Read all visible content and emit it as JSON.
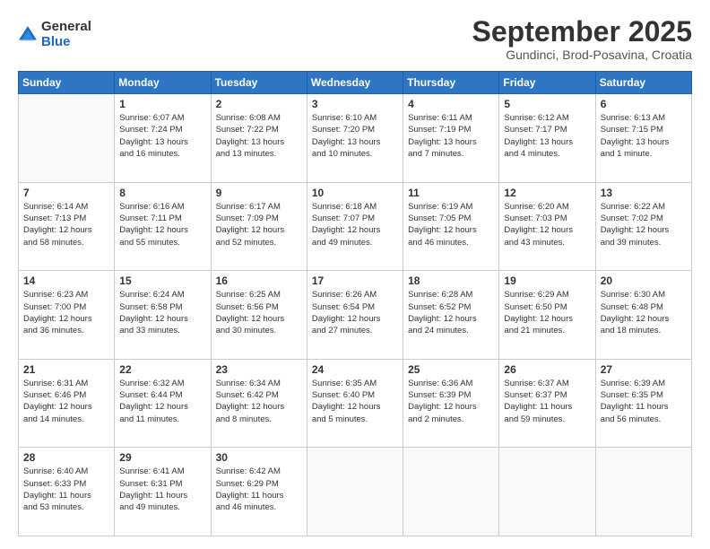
{
  "header": {
    "logo_general": "General",
    "logo_blue": "Blue",
    "month_title": "September 2025",
    "subtitle": "Gundinci, Brod-Posavina, Croatia"
  },
  "days_of_week": [
    "Sunday",
    "Monday",
    "Tuesday",
    "Wednesday",
    "Thursday",
    "Friday",
    "Saturday"
  ],
  "weeks": [
    [
      {
        "day": "",
        "info": ""
      },
      {
        "day": "1",
        "info": "Sunrise: 6:07 AM\nSunset: 7:24 PM\nDaylight: 13 hours\nand 16 minutes."
      },
      {
        "day": "2",
        "info": "Sunrise: 6:08 AM\nSunset: 7:22 PM\nDaylight: 13 hours\nand 13 minutes."
      },
      {
        "day": "3",
        "info": "Sunrise: 6:10 AM\nSunset: 7:20 PM\nDaylight: 13 hours\nand 10 minutes."
      },
      {
        "day": "4",
        "info": "Sunrise: 6:11 AM\nSunset: 7:19 PM\nDaylight: 13 hours\nand 7 minutes."
      },
      {
        "day": "5",
        "info": "Sunrise: 6:12 AM\nSunset: 7:17 PM\nDaylight: 13 hours\nand 4 minutes."
      },
      {
        "day": "6",
        "info": "Sunrise: 6:13 AM\nSunset: 7:15 PM\nDaylight: 13 hours\nand 1 minute."
      }
    ],
    [
      {
        "day": "7",
        "info": "Sunrise: 6:14 AM\nSunset: 7:13 PM\nDaylight: 12 hours\nand 58 minutes."
      },
      {
        "day": "8",
        "info": "Sunrise: 6:16 AM\nSunset: 7:11 PM\nDaylight: 12 hours\nand 55 minutes."
      },
      {
        "day": "9",
        "info": "Sunrise: 6:17 AM\nSunset: 7:09 PM\nDaylight: 12 hours\nand 52 minutes."
      },
      {
        "day": "10",
        "info": "Sunrise: 6:18 AM\nSunset: 7:07 PM\nDaylight: 12 hours\nand 49 minutes."
      },
      {
        "day": "11",
        "info": "Sunrise: 6:19 AM\nSunset: 7:05 PM\nDaylight: 12 hours\nand 46 minutes."
      },
      {
        "day": "12",
        "info": "Sunrise: 6:20 AM\nSunset: 7:03 PM\nDaylight: 12 hours\nand 43 minutes."
      },
      {
        "day": "13",
        "info": "Sunrise: 6:22 AM\nSunset: 7:02 PM\nDaylight: 12 hours\nand 39 minutes."
      }
    ],
    [
      {
        "day": "14",
        "info": "Sunrise: 6:23 AM\nSunset: 7:00 PM\nDaylight: 12 hours\nand 36 minutes."
      },
      {
        "day": "15",
        "info": "Sunrise: 6:24 AM\nSunset: 6:58 PM\nDaylight: 12 hours\nand 33 minutes."
      },
      {
        "day": "16",
        "info": "Sunrise: 6:25 AM\nSunset: 6:56 PM\nDaylight: 12 hours\nand 30 minutes."
      },
      {
        "day": "17",
        "info": "Sunrise: 6:26 AM\nSunset: 6:54 PM\nDaylight: 12 hours\nand 27 minutes."
      },
      {
        "day": "18",
        "info": "Sunrise: 6:28 AM\nSunset: 6:52 PM\nDaylight: 12 hours\nand 24 minutes."
      },
      {
        "day": "19",
        "info": "Sunrise: 6:29 AM\nSunset: 6:50 PM\nDaylight: 12 hours\nand 21 minutes."
      },
      {
        "day": "20",
        "info": "Sunrise: 6:30 AM\nSunset: 6:48 PM\nDaylight: 12 hours\nand 18 minutes."
      }
    ],
    [
      {
        "day": "21",
        "info": "Sunrise: 6:31 AM\nSunset: 6:46 PM\nDaylight: 12 hours\nand 14 minutes."
      },
      {
        "day": "22",
        "info": "Sunrise: 6:32 AM\nSunset: 6:44 PM\nDaylight: 12 hours\nand 11 minutes."
      },
      {
        "day": "23",
        "info": "Sunrise: 6:34 AM\nSunset: 6:42 PM\nDaylight: 12 hours\nand 8 minutes."
      },
      {
        "day": "24",
        "info": "Sunrise: 6:35 AM\nSunset: 6:40 PM\nDaylight: 12 hours\nand 5 minutes."
      },
      {
        "day": "25",
        "info": "Sunrise: 6:36 AM\nSunset: 6:39 PM\nDaylight: 12 hours\nand 2 minutes."
      },
      {
        "day": "26",
        "info": "Sunrise: 6:37 AM\nSunset: 6:37 PM\nDaylight: 11 hours\nand 59 minutes."
      },
      {
        "day": "27",
        "info": "Sunrise: 6:39 AM\nSunset: 6:35 PM\nDaylight: 11 hours\nand 56 minutes."
      }
    ],
    [
      {
        "day": "28",
        "info": "Sunrise: 6:40 AM\nSunset: 6:33 PM\nDaylight: 11 hours\nand 53 minutes."
      },
      {
        "day": "29",
        "info": "Sunrise: 6:41 AM\nSunset: 6:31 PM\nDaylight: 11 hours\nand 49 minutes."
      },
      {
        "day": "30",
        "info": "Sunrise: 6:42 AM\nSunset: 6:29 PM\nDaylight: 11 hours\nand 46 minutes."
      },
      {
        "day": "",
        "info": ""
      },
      {
        "day": "",
        "info": ""
      },
      {
        "day": "",
        "info": ""
      },
      {
        "day": "",
        "info": ""
      }
    ]
  ]
}
